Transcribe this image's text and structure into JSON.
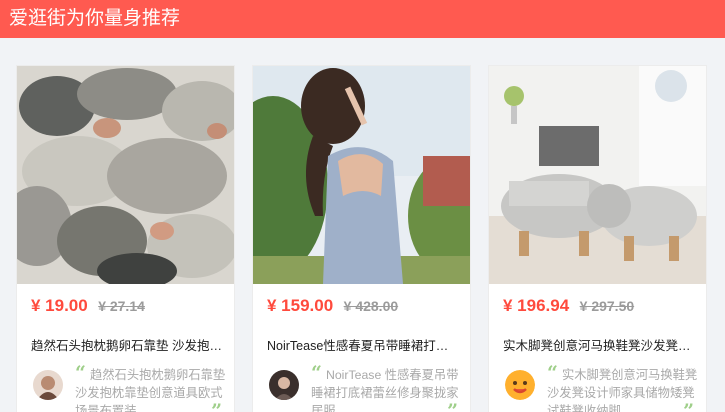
{
  "header": {
    "title": "爱逛街为你量身推荐"
  },
  "cards": [
    {
      "price": "¥ 19.00",
      "old_price": "¥ 27.14",
      "title": "趋然石头抱枕鹅卵石靠垫 沙发抱…",
      "review": "趋然石头抱枕鹅卵石靠垫 沙发抱枕靠垫创意道具欧式场景布置装…"
    },
    {
      "price": "¥ 159.00",
      "old_price": "¥ 428.00",
      "title": "NoirTease性感春夏吊带睡裙打底…",
      "review": "NoirTease 性感春夏吊带睡裙打底裙蕾丝修身聚拢家居服…"
    },
    {
      "price": "¥ 196.94",
      "old_price": "¥ 297.50",
      "title": "实木脚凳创意河马换鞋凳沙发凳设…",
      "review": "实木脚凳创意河马换鞋凳沙发凳设计师家具储物矮凳试鞋凳收纳脚…"
    }
  ],
  "icons": {
    "quote_open": "“",
    "quote_close": "”"
  },
  "colors": {
    "header_bg": "#ff5a50",
    "price": "#ff4a3d",
    "quote": "#9fcf8a"
  }
}
